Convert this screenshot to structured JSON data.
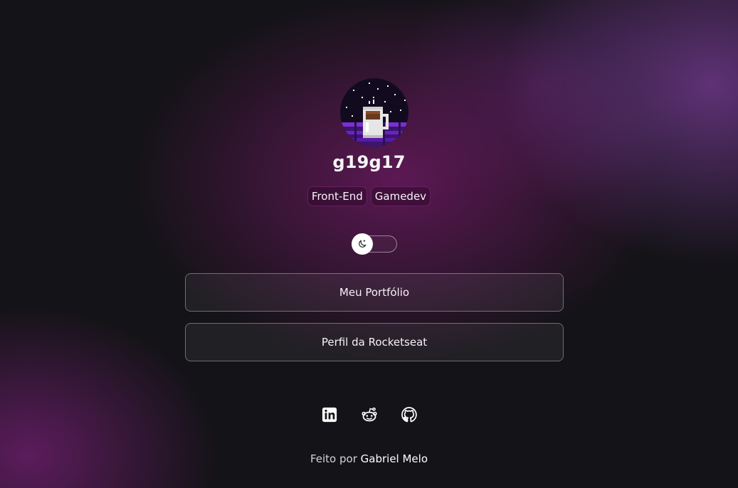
{
  "profile": {
    "username": "g19g17",
    "avatar_icon": "pixel-coffee-mug-night-sky",
    "tags": [
      "Front-End",
      "Gamedev"
    ]
  },
  "theme_switch": {
    "icon": "moon-icon",
    "state": "dark"
  },
  "links": [
    {
      "label": "Meu Portfólio"
    },
    {
      "label": "Perfil da Rocketseat"
    }
  ],
  "socials": [
    {
      "icon": "linkedin-icon"
    },
    {
      "icon": "reddit-icon"
    },
    {
      "icon": "github-icon"
    }
  ],
  "footer": {
    "prefix": "Feito por",
    "author": "Gabriel Melo"
  },
  "colors": {
    "background": "#141317",
    "accent_purple": "#6b1f63",
    "text": "#f4f4f5"
  }
}
